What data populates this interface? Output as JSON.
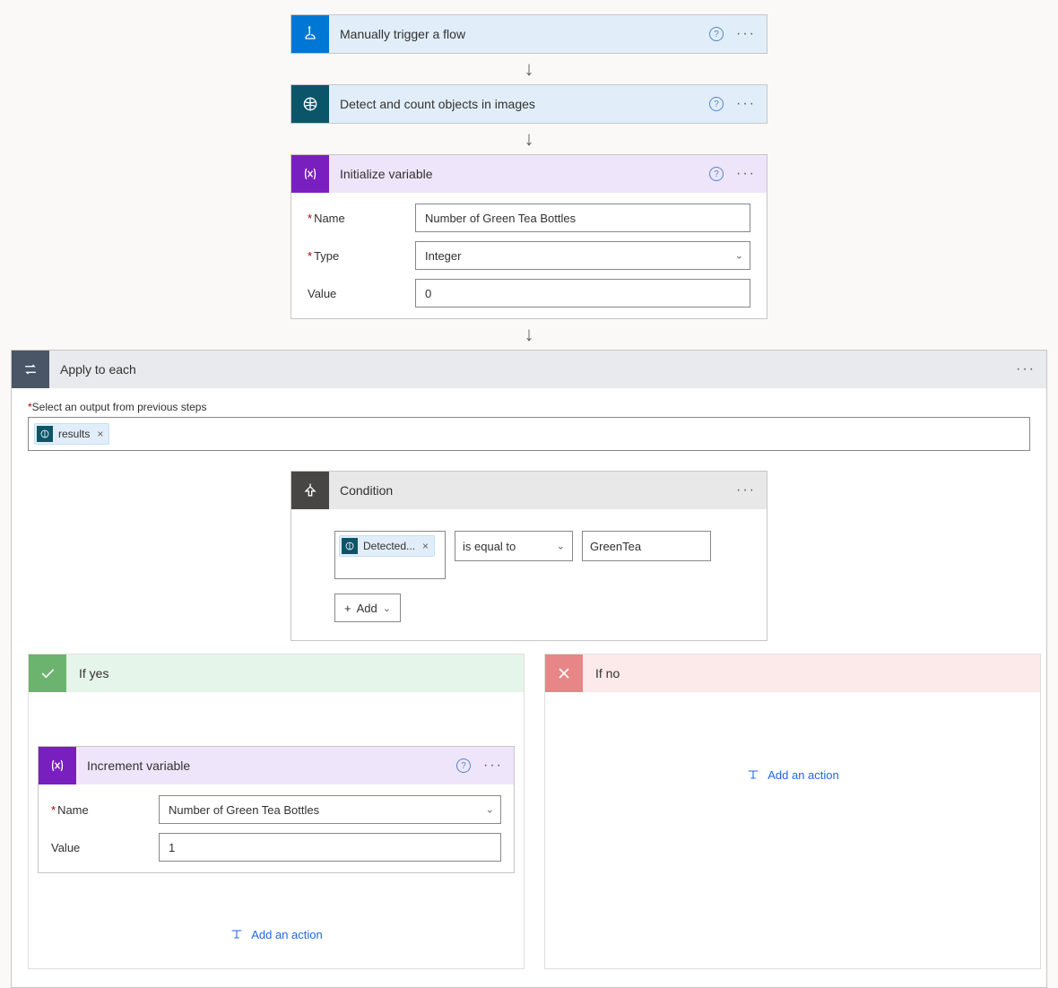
{
  "steps": {
    "trigger": {
      "title": "Manually trigger a flow"
    },
    "detect": {
      "title": "Detect and count objects in images"
    },
    "initVar": {
      "title": "Initialize variable",
      "labels": {
        "name": "Name",
        "type": "Type",
        "value": "Value"
      },
      "name": "Number of Green Tea Bottles",
      "type": "Integer",
      "value": "0"
    }
  },
  "applyToEach": {
    "title": "Apply to each",
    "selectLabel": "Select an output from previous steps",
    "token": {
      "label": "results",
      "remove": "×"
    }
  },
  "condition": {
    "title": "Condition",
    "left": {
      "label": "Detected...",
      "remove": "×"
    },
    "operator": "is equal to",
    "right": "GreenTea",
    "addLabel": "Add"
  },
  "branches": {
    "yes": {
      "title": "If yes",
      "increment": {
        "title": "Increment variable",
        "labels": {
          "name": "Name",
          "value": "Value"
        },
        "name": "Number of Green Tea Bottles",
        "value": "1"
      },
      "addAction": "Add an action"
    },
    "no": {
      "title": "If no",
      "addAction": "Add an action"
    }
  },
  "chart_data": {
    "type": "diagram",
    "flow": "Power Automate cloud flow",
    "nodes": [
      "Manually trigger a flow",
      "Detect and count objects in images",
      "Initialize variable (Number of Green Tea Bottles = 0, Integer)",
      "Apply to each (results)",
      "Condition: Detected... is equal to GreenTea",
      "If yes → Increment variable (Number of Green Tea Bottles by 1)",
      "If no → (empty)"
    ]
  }
}
